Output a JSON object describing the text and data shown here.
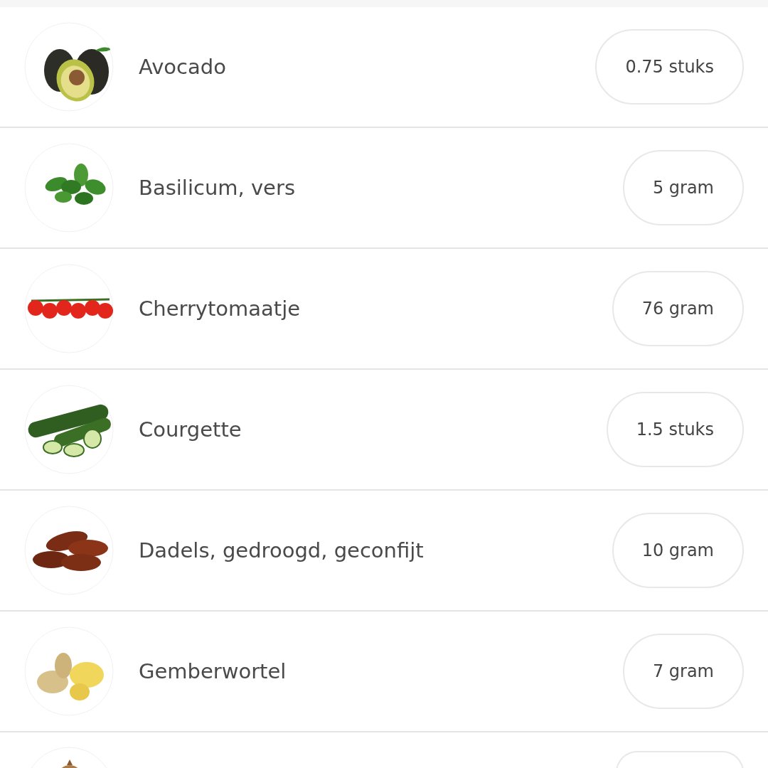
{
  "ingredients": [
    {
      "name": "Avocado",
      "amount": "0.75 stuks",
      "image": {
        "kind": "picture"
      }
    },
    {
      "name": "Basilicum, vers",
      "amount": "5 gram",
      "image": {
        "kind": "picture"
      }
    },
    {
      "name": "Cherrytomaatje",
      "amount": "76 gram",
      "image": {
        "kind": "picture"
      }
    },
    {
      "name": "Courgette",
      "amount": "1.5 stuks",
      "image": {
        "kind": "picture"
      }
    },
    {
      "name": "Dadels, gedroogd, geconfijt",
      "amount": "10 gram",
      "image": {
        "kind": "picture"
      }
    },
    {
      "name": "Gemberwortel",
      "amount": "7 gram",
      "image": {
        "kind": "picture"
      }
    },
    {
      "image": {
        "kind": "picture"
      }
    }
  ]
}
